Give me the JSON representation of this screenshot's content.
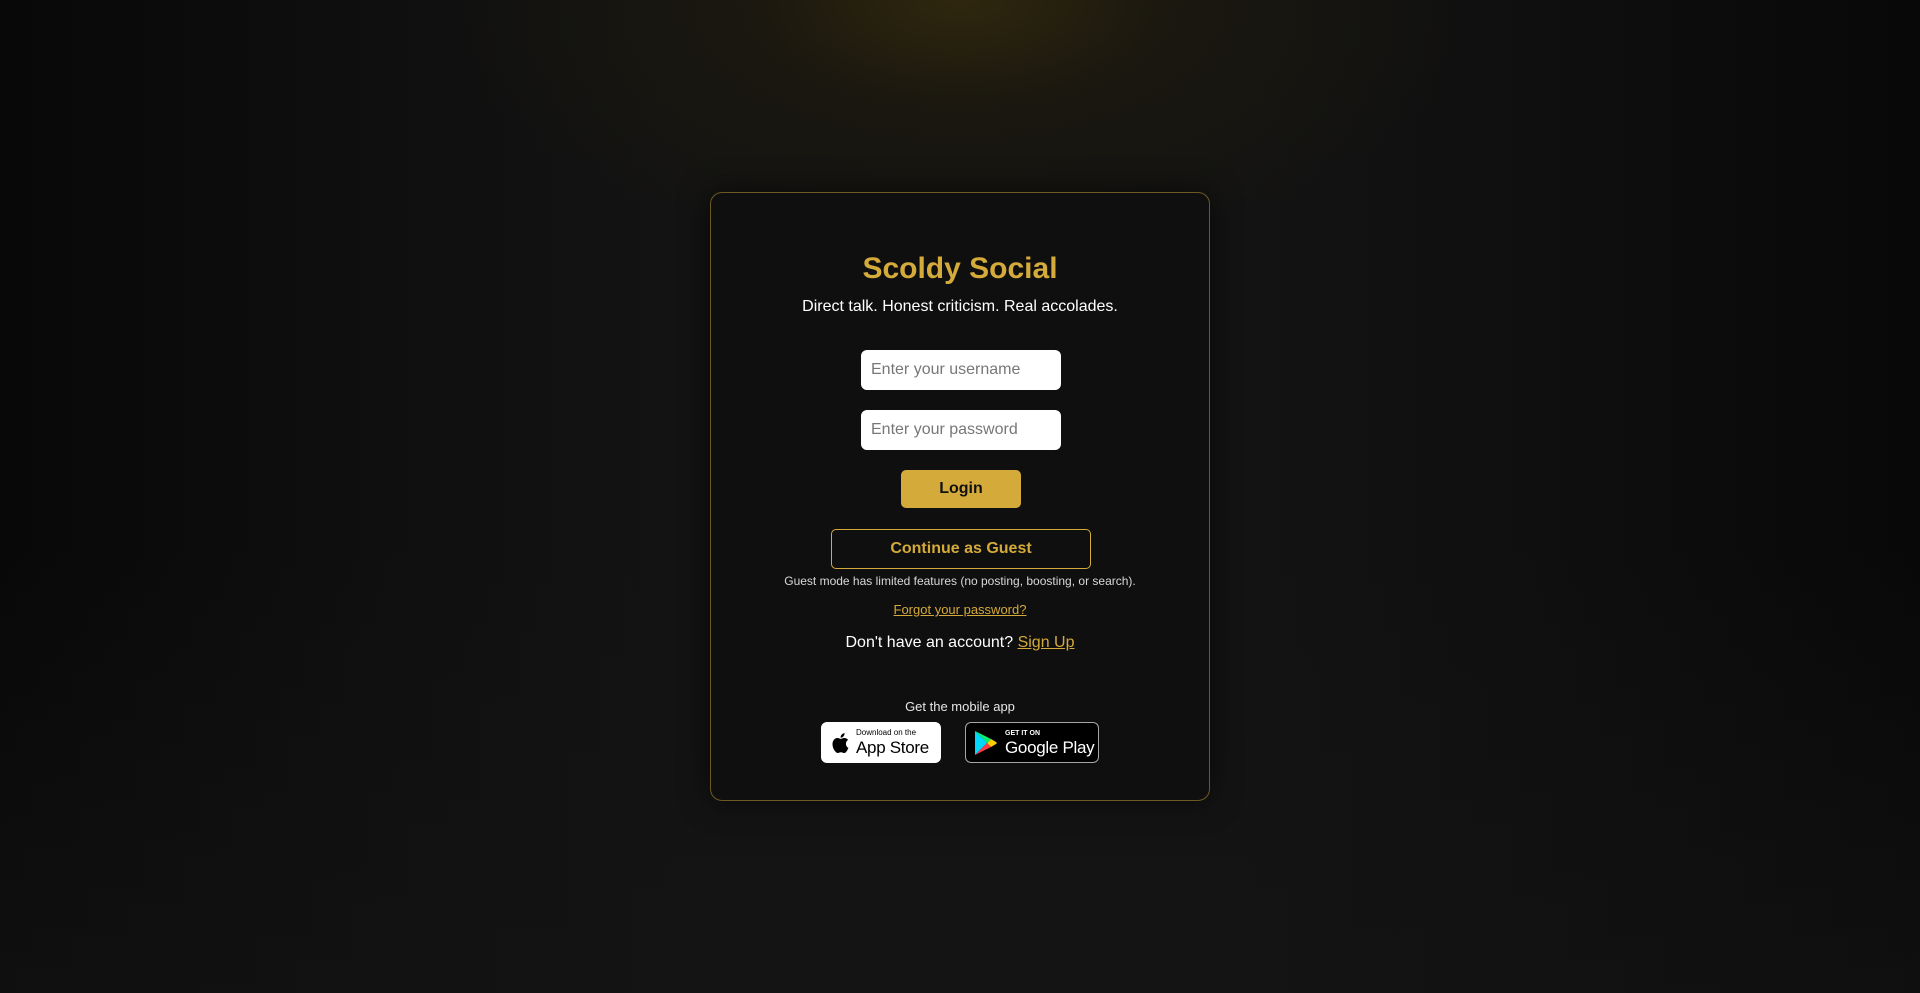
{
  "app": {
    "title": "Scoldy Social",
    "tagline": "Direct talk. Honest criticism. Real accolades."
  },
  "form": {
    "username_placeholder": "Enter your username",
    "username_value": "",
    "password_placeholder": "Enter your password",
    "password_value": "",
    "login_label": "Login",
    "guest_label": "Continue as Guest",
    "guest_note": "Guest mode has limited features (no posting, boosting, or search).",
    "forgot_label": "Forgot your password?",
    "signup_prompt": "Don't have an account?",
    "signup_label": "Sign Up"
  },
  "mobile": {
    "label": "Get the mobile app",
    "appstore_small": "Download on the",
    "appstore_big": "App Store",
    "appstore_icon": "apple-icon",
    "googleplay_small": "GET IT ON",
    "googleplay_big": "Google Play",
    "googleplay_icon": "google-play-icon"
  },
  "colors": {
    "accent": "#d4aa3a",
    "background": "#141414",
    "card_border": "#6b5a22"
  }
}
